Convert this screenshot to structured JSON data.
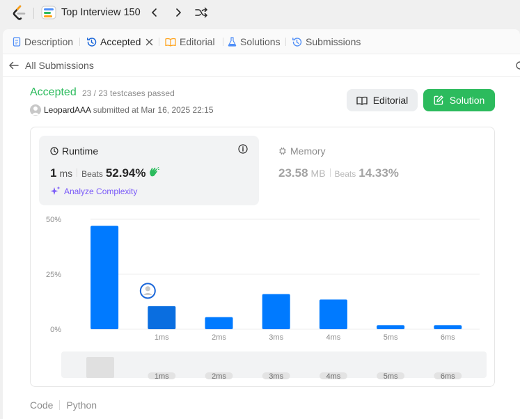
{
  "nav": {
    "title": "Top Interview 150"
  },
  "tabs": [
    {
      "label": "Description"
    },
    {
      "label": "Accepted"
    },
    {
      "label": "Editorial"
    },
    {
      "label": "Solutions"
    },
    {
      "label": "Submissions"
    }
  ],
  "submission": {
    "back_label": "All Submissions",
    "status": "Accepted",
    "testcases": "23 / 23 testcases passed",
    "user": "LeopardAAA",
    "submitted_text": "submitted at Mar 16, 2025 22:15",
    "editorial_button": "Editorial",
    "solution_button": "Solution"
  },
  "runtime": {
    "label": "Runtime",
    "value": "1",
    "unit": "ms",
    "beats_label": "Beats",
    "beats": "52.94%",
    "analyze_label": "Analyze Complexity"
  },
  "memory": {
    "label": "Memory",
    "value": "23.58",
    "unit": "MB",
    "beats_label": "Beats",
    "beats": "14.33%"
  },
  "code": {
    "label": "Code",
    "language": "Python"
  },
  "colors": {
    "accent_green": "#2cbb5d",
    "bar_blue": "#007aff",
    "bar_selected": "#0a6ee0",
    "analyze_purple": "#7a5af8"
  },
  "chart_data": {
    "type": "bar",
    "x_ticks": [
      "",
      "1ms",
      "2ms",
      "3ms",
      "4ms",
      "5ms",
      "6ms"
    ],
    "values": [
      47,
      10.5,
      5.5,
      16,
      13.5,
      1.8,
      1.8
    ],
    "y_ticks": [
      "50%",
      "25%",
      "0%"
    ],
    "ylim": [
      0,
      50
    ],
    "selected_index": 1,
    "grid": true,
    "minimap_labels": [
      "1ms",
      "2ms",
      "3ms",
      "4ms",
      "5ms",
      "6ms"
    ]
  }
}
